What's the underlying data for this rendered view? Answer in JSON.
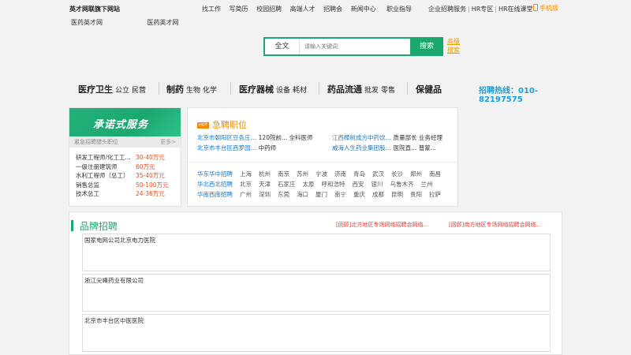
{
  "header": {
    "site_title": "英才网联旗下网站",
    "sub_links": [
      "医药英才网",
      "医药英才网"
    ],
    "nav": [
      "找工作",
      "写简历",
      "校园招聘",
      "高端人才",
      "招聘会",
      "新闻中心"
    ],
    "career": "职业指导",
    "right_links": [
      "企业招聘服务",
      "HR专区",
      "HR在线课堂"
    ],
    "mobile": "手机版"
  },
  "search": {
    "type": "全文",
    "placeholder": "请输入关键词",
    "button": "搜索",
    "advanced_line1": "高级",
    "advanced_line2": "搜索"
  },
  "categories": [
    {
      "main": "医疗卫生",
      "subs": [
        "公立",
        "民营"
      ]
    },
    {
      "main": "制药",
      "subs": [
        "生物",
        "化学"
      ]
    },
    {
      "main": "医疗器械",
      "subs": [
        "设备",
        "耗材"
      ]
    },
    {
      "main": "药品流通",
      "subs": [
        "批发",
        "零售"
      ]
    },
    {
      "main": "保健品",
      "subs": []
    }
  ],
  "hotline": "招聘热线：010-82197575",
  "promise": {
    "title": "承诺式服务",
    "sub": "紧急招聘猎头职位",
    "more": "更多>",
    "jobs": [
      {
        "title": "研发工程师/化工工...",
        "salary": "30-40万元"
      },
      {
        "title": "一级注册建筑师",
        "salary": "60万元"
      },
      {
        "title": "水利工程师（总工）",
        "salary": "35-40万元"
      },
      {
        "title": "销售总监",
        "salary": "50-100万元"
      },
      {
        "title": "技术总工",
        "salary": "24-36万元"
      }
    ]
  },
  "hot": {
    "tag": "HOT",
    "title": "急聘职位",
    "jobs": [
      {
        "company": "北京市朝阳区豆各庄...",
        "position": "120院前... 全科医师"
      },
      {
        "company": "江西樟树成方中药饮...",
        "position": "质量部长 业务经理"
      },
      {
        "company": "北京市丰台区西罗园...",
        "position": "中药师"
      },
      {
        "company": "威海人生药业集团股...",
        "position": "医院直... 普蒙..."
      }
    ],
    "regions": [
      {
        "name": "华东华中招聘",
        "cities": [
          "上海",
          "杭州",
          "南京",
          "苏州",
          "宁波",
          "济南",
          "青岛",
          "武汉",
          "长沙",
          "郑州",
          "南昌"
        ]
      },
      {
        "name": "华北西北招聘",
        "cities": [
          "北京",
          "天津",
          "石家庄",
          "太原",
          "呼和浩特",
          "西安",
          "银川",
          "乌鲁木齐",
          "兰州"
        ]
      },
      {
        "name": "华南西南招聘",
        "cities": [
          "广州",
          "深圳",
          "东莞",
          "海口",
          "厦门",
          "南宁",
          "重庆",
          "成都",
          "昆明",
          "贵阳",
          "拉萨"
        ]
      }
    ]
  },
  "brand": {
    "title": "品牌招聘",
    "news": [
      {
        "tag": "[回顾]",
        "text": "北方地区专场网络招聘会网络..."
      },
      {
        "tag": "[回顾]",
        "text": "南方地区专场网络招聘会网络..."
      }
    ],
    "cards": [
      "国家电网公司北京电力医院",
      "浙江尖峰药业有限公司",
      "北京市丰台区中医医院"
    ]
  },
  "colors": {
    "accent": "#1aa870",
    "orange": "#f08c00",
    "link": "#1a78c2",
    "salary": "#e64a19"
  }
}
